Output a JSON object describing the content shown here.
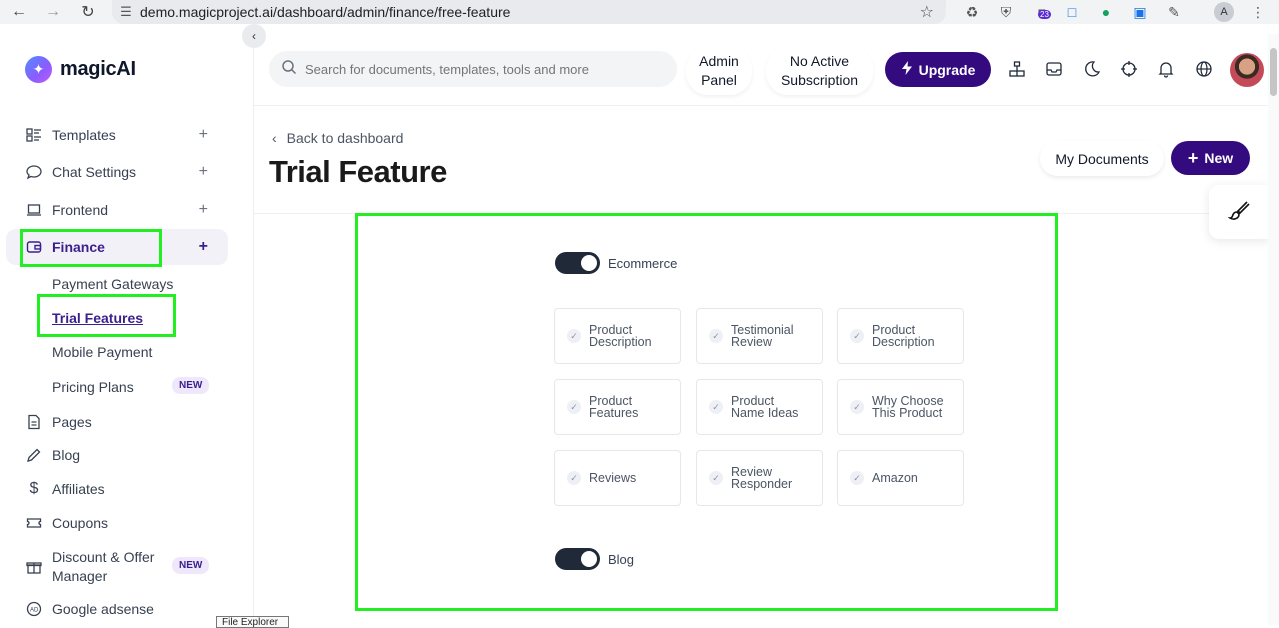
{
  "browser": {
    "url": "demo.magicproject.ai/dashboard/admin/finance/free-feature",
    "ext_badge": "23",
    "profile_initial": "A"
  },
  "app": {
    "logo_text": "magicAI"
  },
  "sidebar": {
    "items": [
      {
        "label": "Templates"
      },
      {
        "label": "Chat Settings"
      },
      {
        "label": "Frontend"
      },
      {
        "label": "Finance"
      },
      {
        "label": "Pages"
      },
      {
        "label": "Blog"
      },
      {
        "label": "Affiliates"
      },
      {
        "label": "Coupons"
      },
      {
        "label": "Discount & Offer Manager"
      },
      {
        "label": "Google adsense"
      }
    ],
    "finance_sub": [
      {
        "label": "Payment Gateways"
      },
      {
        "label": "Trial Features"
      },
      {
        "label": "Mobile Payment"
      },
      {
        "label": "Pricing Plans"
      }
    ],
    "badge_new": "NEW"
  },
  "header": {
    "search_placeholder": "Search for documents, templates, tools and more",
    "admin_panel_line1": "Admin",
    "admin_panel_line2": "Panel",
    "subscription_line1": "No Active",
    "subscription_line2": "Subscription",
    "upgrade_label": "Upgrade"
  },
  "main": {
    "back_label": "Back to dashboard",
    "title": "Trial Feature",
    "my_documents_label": "My Documents",
    "new_label": "New"
  },
  "features": {
    "ecommerce": {
      "label": "Ecommerce",
      "enabled": true,
      "cards": [
        {
          "line1": "Product",
          "line2": "Description"
        },
        {
          "line1": "Testimonial",
          "line2": "Review"
        },
        {
          "line1": "Product",
          "line2": "Description"
        },
        {
          "line1": "Product",
          "line2": "Features"
        },
        {
          "line1": "Product",
          "line2": "Name Ideas"
        },
        {
          "line1": "Why Choose",
          "line2": "This Product"
        },
        {
          "line1": "Reviews",
          "line2": ""
        },
        {
          "line1": "Review",
          "line2": "Responder"
        },
        {
          "line1": "Amazon",
          "line2": ""
        }
      ]
    },
    "blog": {
      "label": "Blog",
      "enabled": true
    }
  },
  "tooltip": "File Explorer",
  "colors": {
    "accent": "#330b7f",
    "highlight": "#22ee22",
    "badge_bg": "#efe7fb"
  }
}
